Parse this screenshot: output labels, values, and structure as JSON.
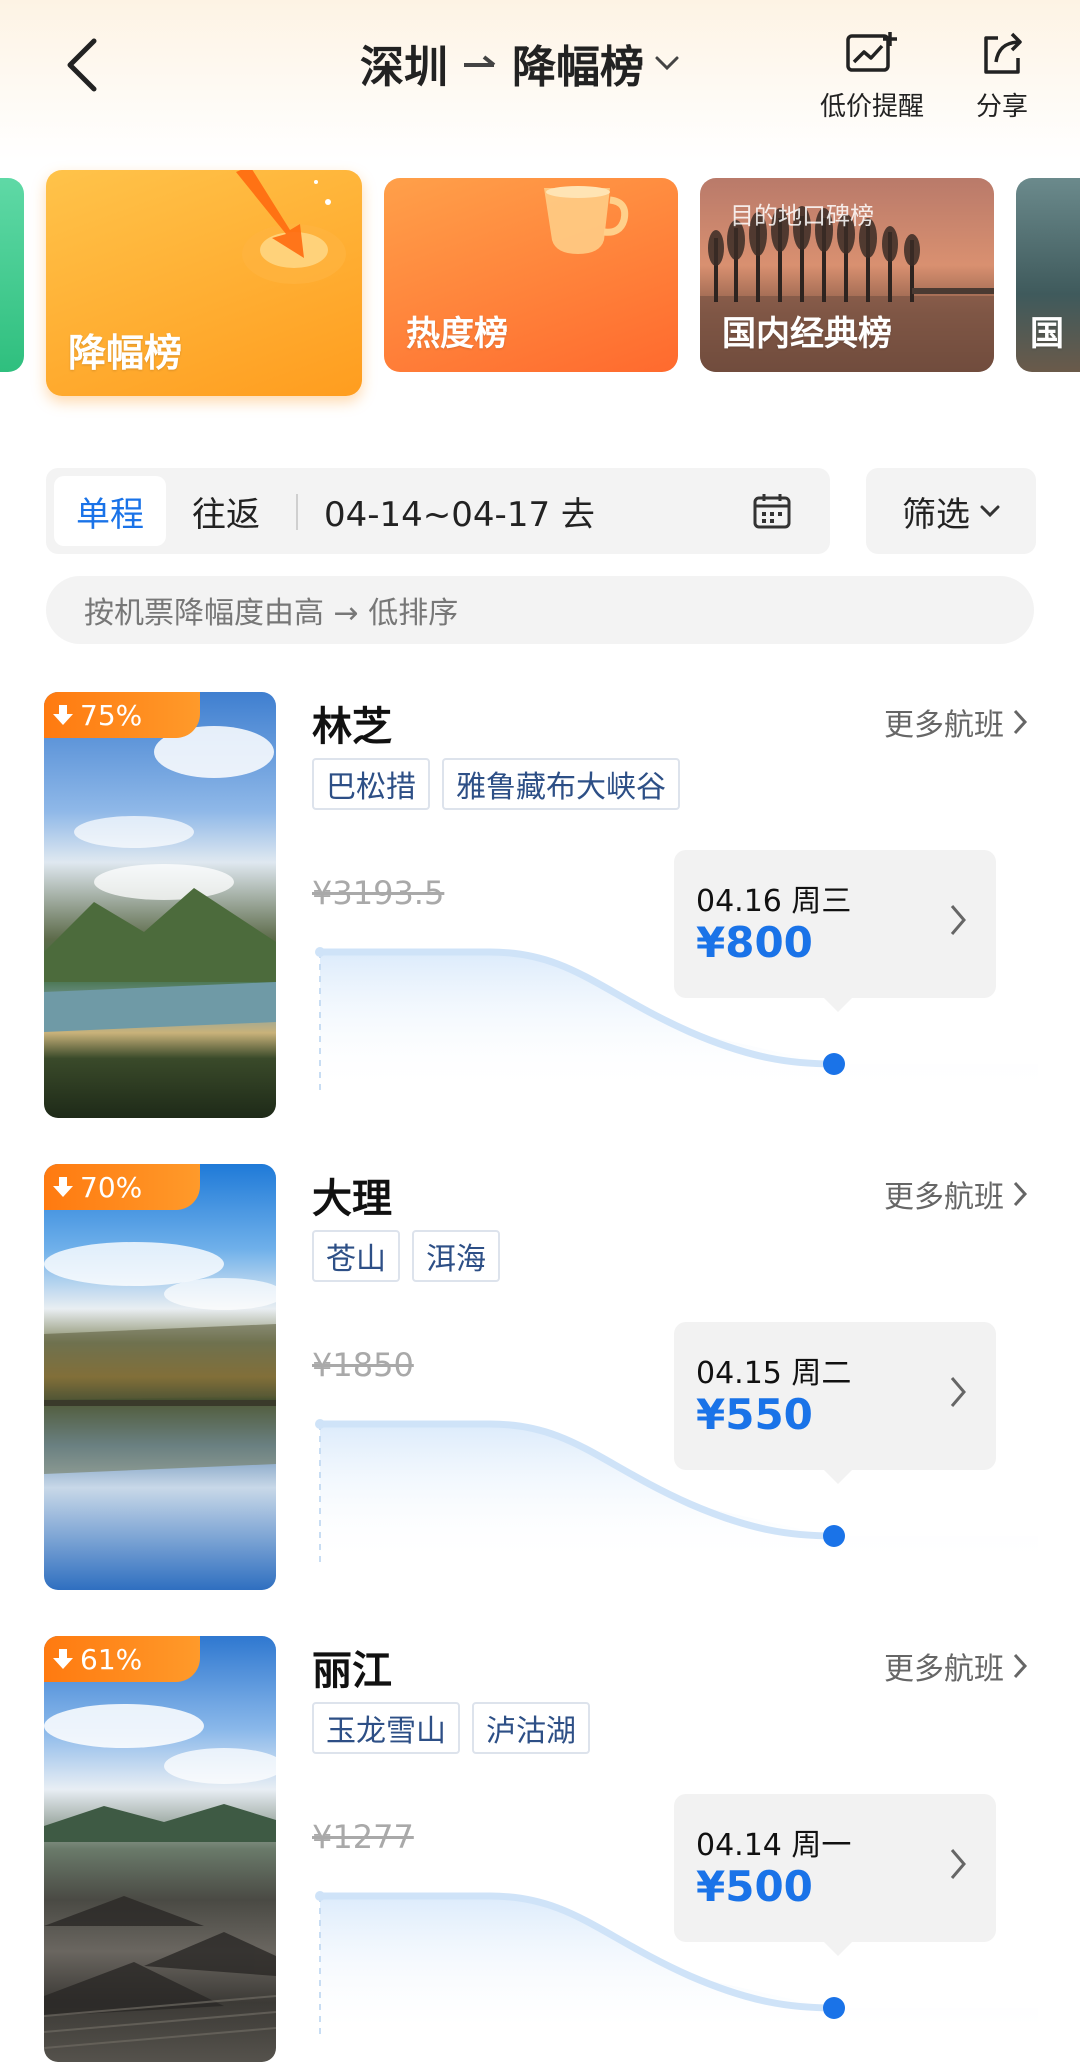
{
  "header": {
    "back_icon": "chevron-left-icon",
    "origin": "深圳",
    "destination": "降幅榜",
    "actions": [
      {
        "icon": "price-alert-icon",
        "label": "低价提醒"
      },
      {
        "icon": "share-icon",
        "label": "分享"
      }
    ]
  },
  "categories": [
    {
      "label": "降幅榜",
      "active": true,
      "color": "#ffa21f"
    },
    {
      "label": "热度榜",
      "active": false,
      "color": "#ff7a2e"
    },
    {
      "label": "国内经典榜",
      "active": false,
      "overlay_text": "目的地口碑榜"
    },
    {
      "label": "国",
      "active": false
    }
  ],
  "filters": {
    "trip_types": [
      "单程",
      "往返"
    ],
    "selected_trip": "单程",
    "date_range": "04-14~04-17 去",
    "calendar_icon": "calendar-icon",
    "filter_label": "筛选",
    "sort_hint": "按机票降幅度由高 → 低排序"
  },
  "destinations": [
    {
      "drop": "75%",
      "name": "林芝",
      "tags": [
        "巴松措",
        "雅鲁藏布大峡谷"
      ],
      "more_label": "更多航班",
      "original_price": "¥3193.5",
      "date": "04.16 周三",
      "price": "¥800"
    },
    {
      "drop": "70%",
      "name": "大理",
      "tags": [
        "苍山",
        "洱海"
      ],
      "more_label": "更多航班",
      "original_price": "¥1850",
      "date": "04.15 周二",
      "price": "¥550"
    },
    {
      "drop": "61%",
      "name": "丽江",
      "tags": [
        "玉龙雪山",
        "泸沽湖"
      ],
      "more_label": "更多航班",
      "original_price": "¥1277",
      "date": "04.14 周一",
      "price": "¥500"
    }
  ],
  "colors": {
    "accent_blue": "#1a73e8",
    "badge_orange": "#ff7a10",
    "tag_text": "#2d4f86"
  }
}
